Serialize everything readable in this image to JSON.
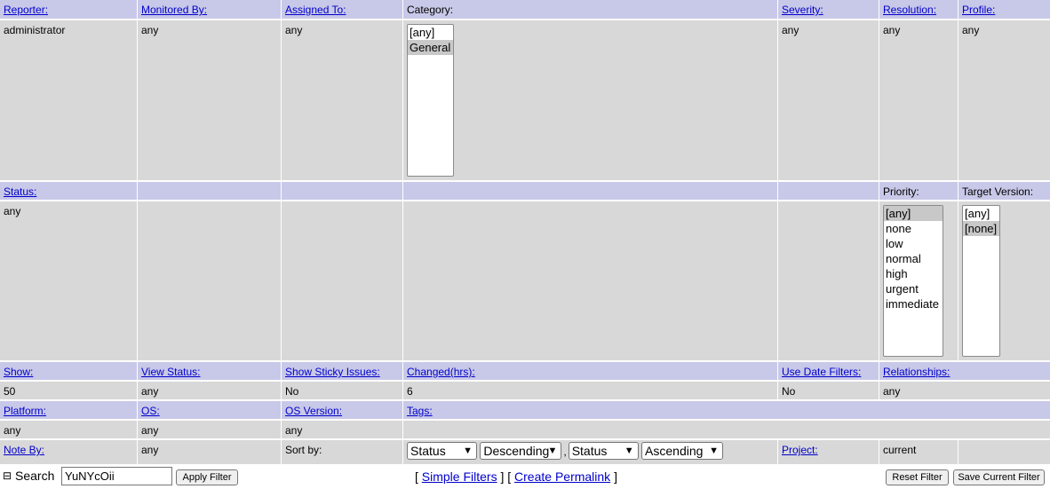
{
  "filters": {
    "row1": {
      "reporter_label": "Reporter:",
      "reporter_value": "administrator",
      "monitored_label": "Monitored By:",
      "monitored_value": "any",
      "assigned_label": "Assigned To:",
      "assigned_value": "any",
      "category_label": "Category:",
      "category_options": [
        "[any]",
        "General"
      ],
      "category_selected": "General",
      "severity_label": "Severity:",
      "severity_value": "any",
      "resolution_label": "Resolution:",
      "resolution_value": "any",
      "profile_label": "Profile:",
      "profile_value": "any"
    },
    "row2": {
      "status_label": "Status:",
      "status_value": "any",
      "priority_label": "Priority:",
      "priority_options": [
        "[any]",
        "none",
        "low",
        "normal",
        "high",
        "urgent",
        "immediate"
      ],
      "priority_selected": "[any]",
      "target_label": "Target Version:",
      "target_options": [
        "[any]",
        "[none]"
      ],
      "target_selected": "[none]"
    },
    "row3": {
      "show_label": "Show:",
      "show_value": "50",
      "view_status_label": "View Status:",
      "view_status_value": "any",
      "sticky_label": "Show Sticky Issues:",
      "sticky_value": "No",
      "changed_label": "Changed(hrs):",
      "changed_value": "6",
      "date_filters_label": "Use Date Filters:",
      "date_filters_value": "No",
      "relationships_label": "Relationships:",
      "relationships_value": "any"
    },
    "row4": {
      "platform_label": "Platform:",
      "platform_value": "any",
      "os_label": "OS:",
      "os_value": "any",
      "os_version_label": "OS Version:",
      "os_version_value": "any",
      "tags_label": "Tags:"
    },
    "row5": {
      "note_by_label": "Note By:",
      "note_by_value": "any",
      "sort_by_label": "Sort by:",
      "sort1_field": "Status",
      "sort1_dir": "Descending",
      "sort_separator": ",",
      "sort2_field": "Status",
      "sort2_dir": "Ascending",
      "project_label": "Project:",
      "project_value": "current"
    }
  },
  "bottom": {
    "collapse_glyph": "⊟",
    "search_label": "Search",
    "search_value": "YuNYcOii",
    "apply_button": "Apply Filter",
    "bracket_open": "[",
    "simple_filters": "Simple Filters",
    "bracket_mid": "] [",
    "create_permalink": "Create Permalink",
    "bracket_close": "]",
    "reset_button": "Reset Filter",
    "save_button": "Save Current Filter"
  }
}
